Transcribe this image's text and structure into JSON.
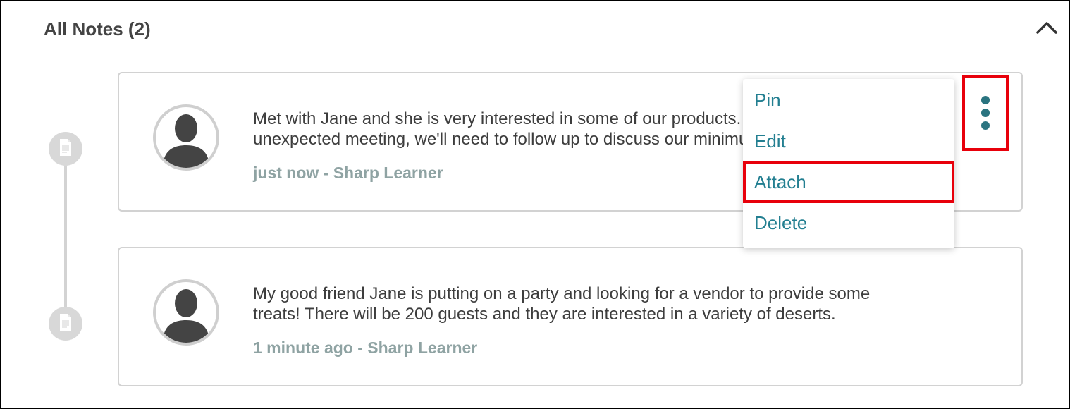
{
  "section": {
    "title": "All Notes (2)",
    "collapse_icon": "chevron-up-icon"
  },
  "notes": [
    {
      "text_lines": [
        "Met with Jane and she is very interested in some of our products. Due to the",
        "unexpected meeting, we'll need to follow up to discuss our minimum order."
      ],
      "meta": "just now - Sharp Learner",
      "avatar_icon": "user-silhouette-icon",
      "timeline_icon": "document-icon"
    },
    {
      "text_lines": [
        "My good friend Jane is putting on a party and looking for a vendor to provide some",
        "treats! There will be 200 guests and they are interested in a variety of deserts."
      ],
      "meta": "1 minute ago - Sharp Learner",
      "avatar_icon": "user-silhouette-icon",
      "timeline_icon": "document-icon"
    }
  ],
  "menu": {
    "trigger_icon": "kebab-menu-icon",
    "items": [
      {
        "label": "Pin"
      },
      {
        "label": "Edit"
      },
      {
        "label": "Attach",
        "highlighted": true
      },
      {
        "label": "Delete"
      }
    ]
  },
  "colors": {
    "accent": "#237f91",
    "kebab": "#2a7480",
    "highlight": "#e8000b",
    "meta_text": "#8fa3a3",
    "body_text": "#3d3d3d",
    "timeline": "#d8d8d8"
  }
}
